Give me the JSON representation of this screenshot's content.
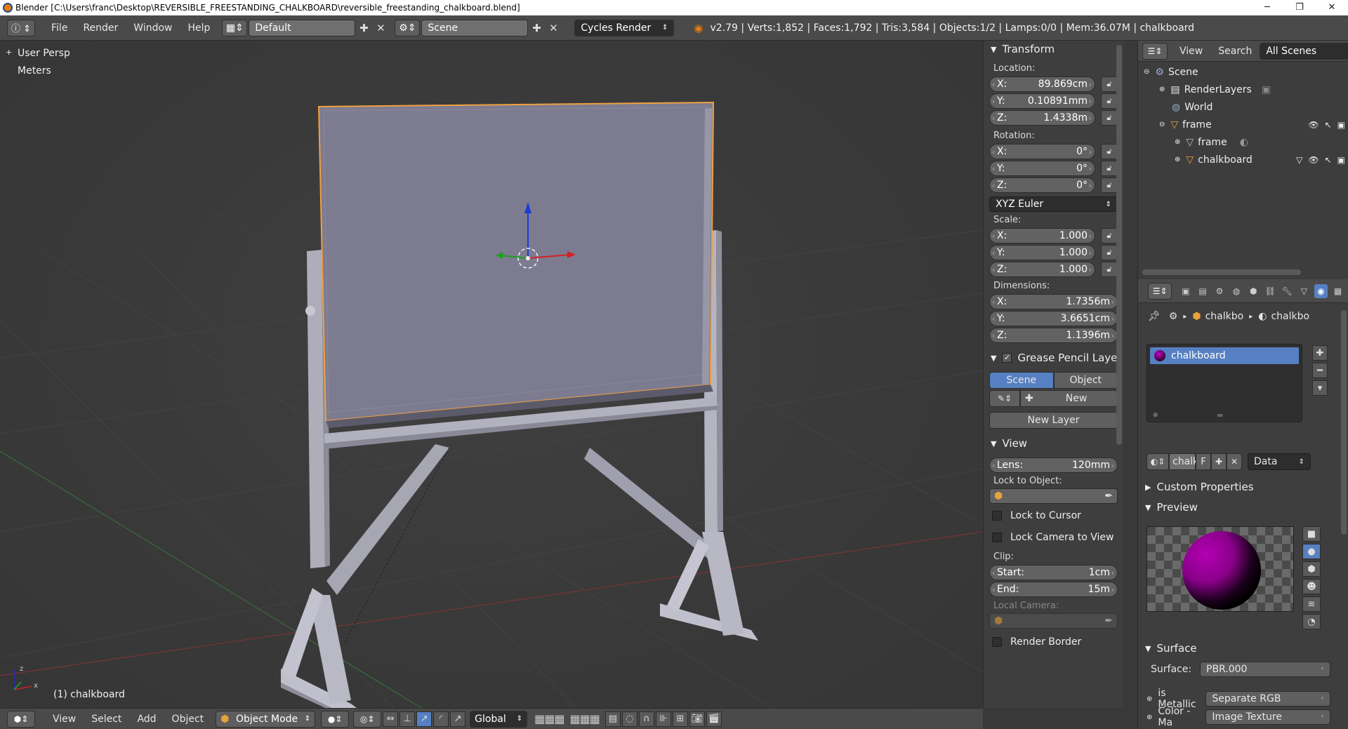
{
  "window": {
    "title": "Blender [C:\\Users\\franc\\Desktop\\REVERSIBLE_FREESTANDING_CHALKBOARD\\reversible_freestanding_chalkboard.blend]",
    "controls": [
      "─",
      "❐",
      "✕"
    ]
  },
  "infobar": {
    "menus": [
      "File",
      "Render",
      "Window",
      "Help"
    ],
    "layout": "Default",
    "scene": "Scene",
    "engine": "Cycles Render",
    "stats": "v2.79 | Verts:1,852 | Faces:1,792 | Tris:3,584 | Objects:1/2 | Lamps:0/0 | Mem:36.07M | chalkboard"
  },
  "viewport": {
    "view_name": "User Persp",
    "units": "Meters",
    "object_label": "(1) chalkboard"
  },
  "bottombar": {
    "menus": [
      "View",
      "Select",
      "Add",
      "Object"
    ],
    "mode": "Object Mode",
    "orientation": "Global"
  },
  "transform": {
    "header": "Transform",
    "location_label": "Location:",
    "location": [
      {
        "axis": "X:",
        "value": "89.869cm"
      },
      {
        "axis": "Y:",
        "value": "0.10891mm"
      },
      {
        "axis": "Z:",
        "value": "1.4338m"
      }
    ],
    "rotation_label": "Rotation:",
    "rotation": [
      {
        "axis": "X:",
        "value": "0°"
      },
      {
        "axis": "Y:",
        "value": "0°"
      },
      {
        "axis": "Z:",
        "value": "0°"
      }
    ],
    "rotation_mode": "XYZ Euler",
    "scale_label": "Scale:",
    "scale": [
      {
        "axis": "X:",
        "value": "1.000"
      },
      {
        "axis": "Y:",
        "value": "1.000"
      },
      {
        "axis": "Z:",
        "value": "1.000"
      }
    ],
    "dimensions_label": "Dimensions:",
    "dimensions": [
      {
        "axis": "X:",
        "value": "1.7356m"
      },
      {
        "axis": "Y:",
        "value": "3.6651cm"
      },
      {
        "axis": "Z:",
        "value": "1.1396m"
      }
    ]
  },
  "grease_pencil": {
    "header": "Grease Pencil Layer",
    "scene_tab": "Scene",
    "object_tab": "Object",
    "new_label": "New",
    "new_layer_label": "New Layer"
  },
  "view_panel": {
    "header": "View",
    "lens_label": "Lens:",
    "lens_value": "120mm",
    "lock_to_object_label": "Lock to Object:",
    "lock_to_cursor": "Lock to Cursor",
    "lock_camera": "Lock Camera to View",
    "clip_label": "Clip:",
    "clip_start_label": "Start:",
    "clip_start": "1cm",
    "clip_end_label": "End:",
    "clip_end": "15m",
    "local_camera_label": "Local Camera:",
    "render_border": "Render Border"
  },
  "outliner": {
    "menus": [
      "View",
      "Search"
    ],
    "filter": "All Scenes",
    "items": [
      {
        "label": "Scene",
        "indent": 0
      },
      {
        "label": "RenderLayers",
        "indent": 1
      },
      {
        "label": "World",
        "indent": 1
      },
      {
        "label": "frame",
        "indent": 1
      },
      {
        "label": "frame",
        "indent": 2
      },
      {
        "label": "chalkboard",
        "indent": 2
      }
    ]
  },
  "properties": {
    "breadcrumb_object": "chalkbo",
    "breadcrumb_material": "chalkbo",
    "material_slot": "chalkboard",
    "material_name": "chalk",
    "fake_user": "F",
    "link": "Data",
    "custom_properties": "Custom Properties",
    "preview": "Preview",
    "surface_header": "Surface",
    "surface_label": "Surface:",
    "surface_value": "PBR.000",
    "is_metallic_label": "is Metallic",
    "is_metallic_value": "Separate RGB",
    "color_label": "Color - Ma",
    "color_value": "Image Texture"
  },
  "colors": {
    "selected_blue": "#5680c2",
    "board_face": "#7d7b90",
    "frame_wood": "#b1b0bd",
    "selection_outline": "#f0a040",
    "material_magenta": "#b400b4"
  }
}
